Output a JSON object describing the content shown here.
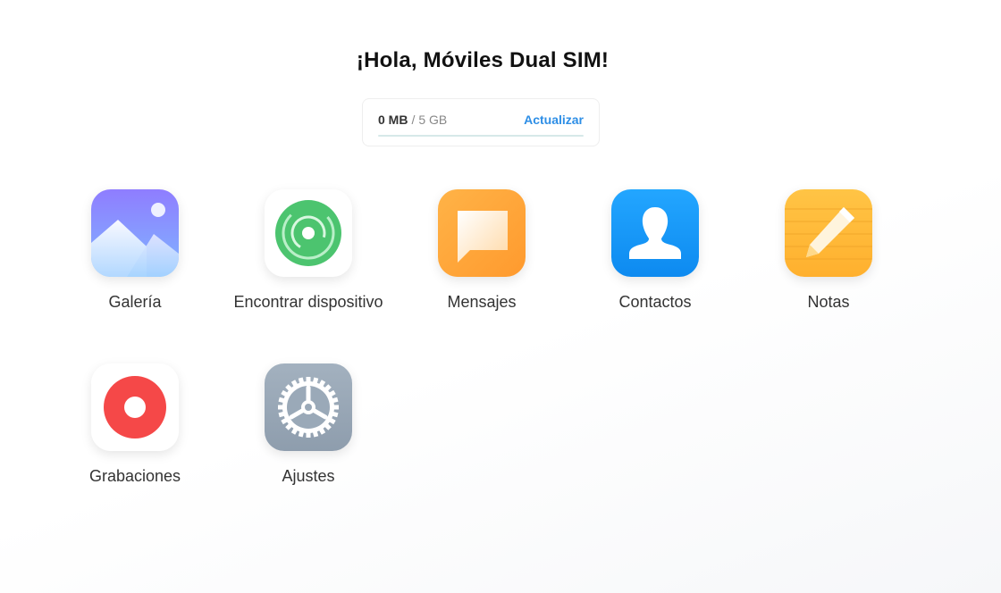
{
  "greeting": "¡Hola, Móviles Dual SIM!",
  "storage": {
    "used": "0 MB",
    "separator": "/",
    "total": "5 GB",
    "update_label": "Actualizar",
    "used_fraction": 0
  },
  "apps": [
    {
      "label": "Galería",
      "icon": "gallery-icon"
    },
    {
      "label": "Encontrar dispositivo",
      "icon": "find-device-icon"
    },
    {
      "label": "Mensajes",
      "icon": "messages-icon"
    },
    {
      "label": "Contactos",
      "icon": "contacts-icon"
    },
    {
      "label": "Notas",
      "icon": "notes-icon"
    },
    {
      "label": "Grabaciones",
      "icon": "recorder-icon"
    },
    {
      "label": "Ajustes",
      "icon": "settings-icon"
    }
  ],
  "colors": {
    "accent": "#2d8ee6",
    "find_device": "#4cc46f",
    "messages": "#ffa63a",
    "contacts": "#1596f7",
    "notes": "#ffbe3c",
    "recorder": "#f54848",
    "settings": "#9aa9b8"
  }
}
